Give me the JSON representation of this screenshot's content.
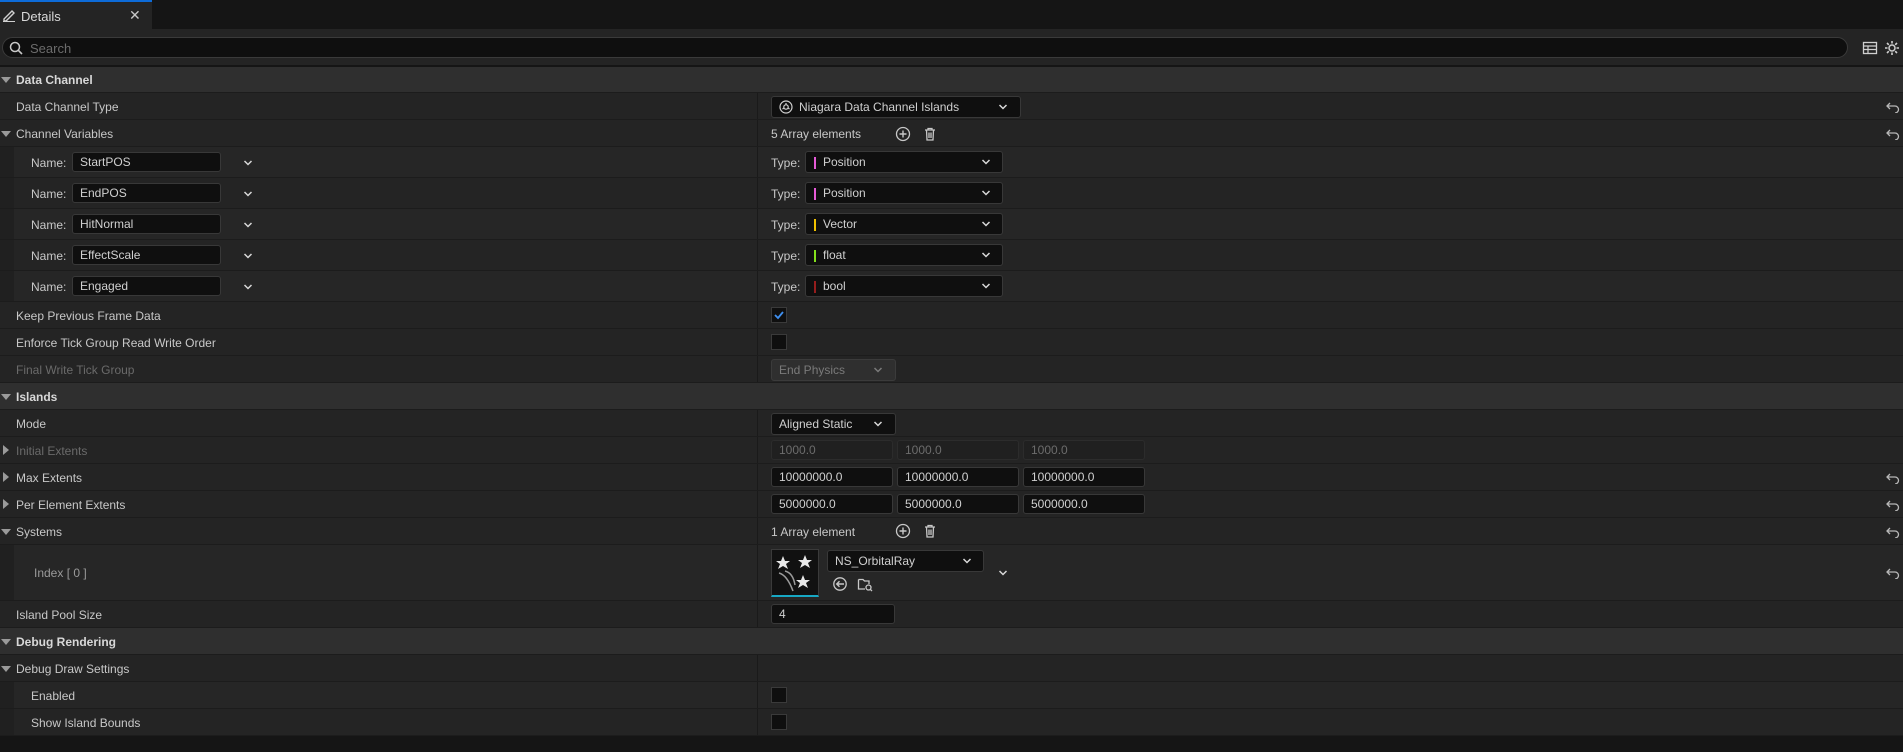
{
  "tab": {
    "title": "Details"
  },
  "search": {
    "placeholder": "Search"
  },
  "colors": {
    "accent": "#0d6bd8",
    "position_pin": "#e65ad7",
    "vector_pin": "#f0c000",
    "float_pin": "#84e01c",
    "bool_pin": "#951d1d",
    "thumb_underline": "#17a8c4"
  },
  "data_channel": {
    "header": "Data Channel",
    "type_label": "Data Channel Type",
    "type_value": "Niagara Data Channel Islands",
    "channel_variables": {
      "label": "Channel Variables",
      "count": "5 Array elements",
      "name_label": "Name:",
      "type_label": "Type:",
      "items": [
        {
          "name": "StartPOS",
          "type": "Position"
        },
        {
          "name": "EndPOS",
          "type": "Position"
        },
        {
          "name": "HitNormal",
          "type": "Vector"
        },
        {
          "name": "EffectScale",
          "type": "float"
        },
        {
          "name": "Engaged",
          "type": "bool"
        }
      ]
    },
    "keep_previous": {
      "label": "Keep Previous Frame Data",
      "checked": true
    },
    "enforce_tick": {
      "label": "Enforce Tick Group Read Write Order",
      "checked": false
    },
    "final_write": {
      "label": "Final Write Tick Group",
      "value": "End Physics"
    }
  },
  "islands": {
    "header": "Islands",
    "mode": {
      "label": "Mode",
      "value": "Aligned Static"
    },
    "initial_extents": {
      "label": "Initial Extents",
      "values": [
        "1000.0",
        "1000.0",
        "1000.0"
      ]
    },
    "max_extents": {
      "label": "Max Extents",
      "values": [
        "10000000.0",
        "10000000.0",
        "10000000.0"
      ]
    },
    "per_element_extents": {
      "label": "Per Element Extents",
      "values": [
        "5000000.0",
        "5000000.0",
        "5000000.0"
      ]
    },
    "systems": {
      "label": "Systems",
      "count": "1 Array element",
      "index_label": "Index [ 0 ]",
      "asset": "NS_OrbitalRay"
    },
    "pool_size": {
      "label": "Island Pool Size",
      "value": "4"
    }
  },
  "debug": {
    "header": "Debug Rendering",
    "draw_settings": "Debug Draw Settings",
    "enabled": {
      "label": "Enabled",
      "checked": false
    },
    "show_bounds": {
      "label": "Show Island Bounds",
      "checked": false
    }
  }
}
